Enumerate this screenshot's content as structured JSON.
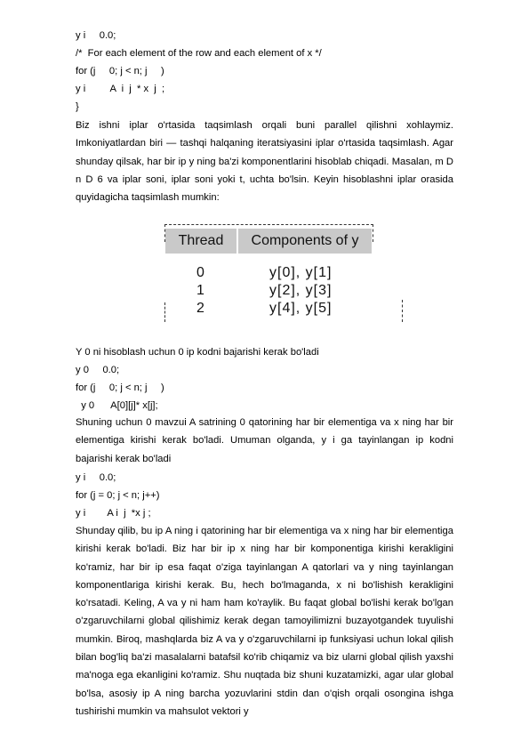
{
  "code1": [
    "y i     0.0;",
    "/*  For each element of the row and each element of x */",
    "for (j     0; j < n; j     )",
    "y i         A  i  j  * x  j  ;",
    "}"
  ],
  "paragraph1": "Biz  ishni  iplar  o'rtasida  taqsimlash  orqali  buni  parallel  qilishni  xohlaymiz. Imkoniyatlardan  biri  —  tashqi  halqaning  iteratsiyasini  iplar  o'rtasida  taqsimlash. Agar  shunday  qilsak,  har  bir  ip  y  ning  ba'zi  komponentlarini  hisoblab  chiqadi. Masalan, m D n D 6 va iplar soni, iplar soni yoki t, uchta bo'lsin. Keyin hisoblashni iplar orasida quyidagicha taqsimlash mumkin:",
  "table": {
    "headers": [
      "Thread",
      "Components of y"
    ],
    "rows": [
      {
        "thread": "0",
        "components": "y[0], y[1]"
      },
      {
        "thread": "1",
        "components": "y[2], y[3]"
      },
      {
        "thread": "2",
        "components": "y[4], y[5]"
      }
    ]
  },
  "sentence2": "Y 0 ni hisoblash uchun 0 ip kodni bajarishi kerak bo'ladi",
  "code2": [
    "y 0     0.0;",
    "for (j     0; j < n; j     )",
    "  y 0      A[0][j]* x[j];"
  ],
  "paragraph2": "Shuning uchun 0 mavzui A satrining 0 qatorining har bir elementiga va x ning har bir elementiga kirishi kerak bo'ladi. Umuman olganda, y i  ga tayinlangan ip kodni bajarishi kerak bo'ladi",
  "code3": [
    "y i     0.0;",
    "for (j = 0; j < n; j++)",
    "y i        A i  j  *x j ;"
  ],
  "paragraph3": "Shunday  qilib,  bu  ip  A  ning  i  qatorining  har  bir  elementiga  va  x  ning  har  bir elementiga kirishi kerak bo'ladi. Biz har bir ip x ning har bir komponentiga kirishi kerakligini  ko'ramiz,  har  bir  ip  esa  faqat  o'ziga  tayinlangan  A  qatorlari  va  y  ning tayinlangan  komponentlariga  kirishi  kerak.  Bu,  hech  bo'lmaganda,  x  ni  bo'lishish kerakligini  ko'rsatadi.  Keling,  A  va  y  ni  ham  ham  ko'raylik.  Bu  faqat  global bo'lishi kerak bo'lgan o'zgaruvchilarni global qilishimiz kerak degan tamoyilimizni buzayotgandek tuyulishi mumkin. Biroq, mashqlarda biz A va y o'zgaruvchilarni ip funksiyasi uchun lokal qilish bilan bog'liq ba'zi masalalarni batafsil ko'rib chiqamiz va biz ularni global qilish yaxshi ma'noga ega ekanligini ko'ramiz. Shu nuqtada biz shuni  kuzatamizki,  agar  ular  global  bo'lsa,  asosiy  ip  A  ning  barcha  yozuvlarini stdin  dan  o'qish  orqali  osongina  ishga  tushirishi  mumkin  va  mahsulot  vektori  y"
}
